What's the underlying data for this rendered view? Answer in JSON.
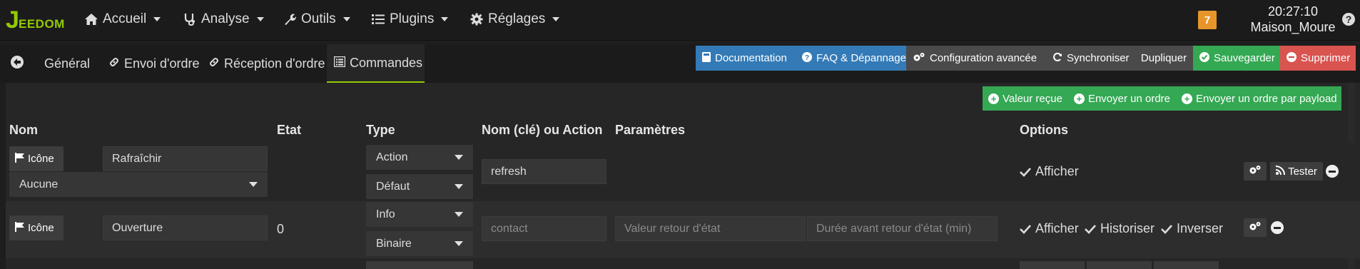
{
  "app": {
    "logo_letter": "J",
    "logo_text": "EEDOM",
    "accent": "#94ca02"
  },
  "nav": {
    "items": [
      {
        "label": "Accueil",
        "icon": "home-icon"
      },
      {
        "label": "Analyse",
        "icon": "stethoscope-icon"
      },
      {
        "label": "Outils",
        "icon": "wrench-icon"
      },
      {
        "label": "Plugins",
        "icon": "tasks-icon"
      },
      {
        "label": "Réglages",
        "icon": "gear-icon"
      }
    ],
    "badge_count": "7",
    "time": "20:27:10",
    "location": "Maison_Moure"
  },
  "tabs": {
    "back": "back-arrow-icon",
    "items": [
      {
        "label": "Général"
      },
      {
        "label": "Envoi d'ordre",
        "icon": "link-icon"
      },
      {
        "label": "Réception d'ordre",
        "icon": "link-icon"
      },
      {
        "label": "Commandes",
        "icon": "list-icon"
      }
    ]
  },
  "toolbar": {
    "documentation": "Documentation",
    "faq": "FAQ & Dépannage",
    "config": "Configuration avancée",
    "sync": "Synchroniser",
    "duplicate": "Dupliquer",
    "save": "Sauvegarder",
    "delete": "Supprimer",
    "colors": {
      "blue": "#337ab7",
      "grey": "#4a4a4a",
      "green": "#34a853",
      "red": "#d9534f"
    }
  },
  "add_buttons": {
    "received": "Valeur reçue",
    "send": "Envoyer un ordre",
    "send_payload": "Envoyer un ordre par payload"
  },
  "table": {
    "headers": {
      "name": "Nom",
      "state": "Etat",
      "type": "Type",
      "key": "Nom (clé) ou Action",
      "params": "Paramètres",
      "options": "Options"
    },
    "icon_button": "Icône",
    "rows": [
      {
        "name": "Rafraîchir",
        "object": "Aucune",
        "state": "",
        "type": "Action",
        "subtype": "Défaut",
        "key": "refresh",
        "options": {
          "show": "Afficher"
        },
        "test": "Tester"
      },
      {
        "name": "Ouverture",
        "state": "0",
        "type": "Info",
        "subtype": "Binaire",
        "key_placeholder": "contact",
        "return_value_placeholder": "Valeur retour d'état",
        "return_delay_placeholder": "Durée avant retour d'état (min)",
        "options": {
          "show": "Afficher",
          "history": "Historiser",
          "invert": "Inverser"
        }
      }
    ]
  }
}
